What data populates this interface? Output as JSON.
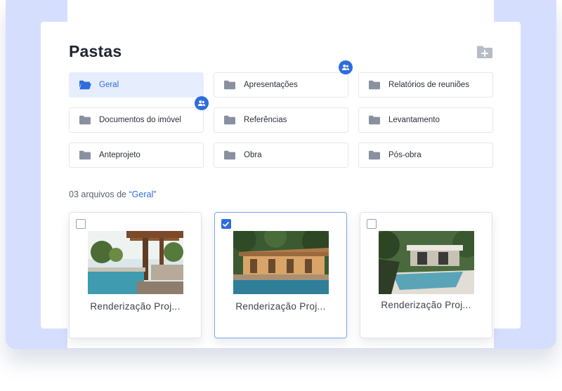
{
  "header": {
    "title": "Pastas"
  },
  "toolbar": {
    "new_folder_icon": "folder-plus-icon"
  },
  "folders": [
    {
      "label": "Geral",
      "icon": "folder-open-icon",
      "active": true
    },
    {
      "label": "Apresentações",
      "icon": "folder-icon",
      "shared": true
    },
    {
      "label": "Relatórios de reuniões",
      "icon": "folder-icon"
    },
    {
      "label": "Documentos do imóvel",
      "icon": "folder-icon",
      "shared": true
    },
    {
      "label": "Referências",
      "icon": "folder-icon"
    },
    {
      "label": "Levantamento",
      "icon": "folder-icon"
    },
    {
      "label": "Anteprojeto",
      "icon": "folder-icon"
    },
    {
      "label": "Obra",
      "icon": "folder-icon"
    },
    {
      "label": "Pós-obra",
      "icon": "folder-icon"
    }
  ],
  "files": {
    "count_text": "03 arquivos de",
    "folder_quoted": "“Geral”",
    "items": [
      {
        "name": "Renderização Proj...",
        "checked": false
      },
      {
        "name": "Renderização Proj...",
        "checked": true
      },
      {
        "name": "Renderização Proj...",
        "checked": false
      }
    ]
  },
  "colors": {
    "accent": "#2e6ddb",
    "active_bg": "#e6edfd",
    "backdrop": "#d5dffd",
    "folder_icon": "#8a90a0"
  }
}
